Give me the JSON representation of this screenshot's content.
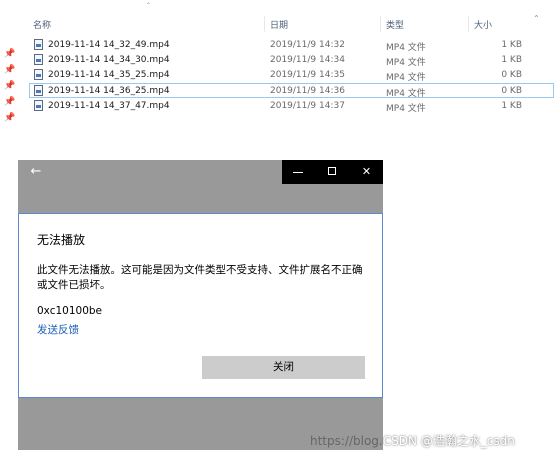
{
  "explorer": {
    "columns": {
      "name": "名称",
      "date": "日期",
      "type": "类型",
      "size": "大小"
    },
    "files": [
      {
        "name": "2019-11-14 14_32_49.mp4",
        "date": "2019/11/9 14:32",
        "type": "MP4 文件",
        "size": "1 KB",
        "selected": false
      },
      {
        "name": "2019-11-14 14_34_30.mp4",
        "date": "2019/11/9 14:34",
        "type": "MP4 文件",
        "size": "1 KB",
        "selected": false
      },
      {
        "name": "2019-11-14 14_35_25.mp4",
        "date": "2019/11/9 14:35",
        "type": "MP4 文件",
        "size": "0 KB",
        "selected": false
      },
      {
        "name": "2019-11-14 14_36_25.mp4",
        "date": "2019/11/9 14:36",
        "type": "MP4 文件",
        "size": "0 KB",
        "selected": true
      },
      {
        "name": "2019-11-14 14_37_47.mp4",
        "date": "2019/11/9 14:37",
        "type": "MP4 文件",
        "size": "1 KB",
        "selected": false
      }
    ],
    "icons": {
      "pin": "pin-icon",
      "file": "file-icon",
      "sort": "sort-indicator-icon",
      "collapse": "chevron-up-icon"
    }
  },
  "player": {
    "controls": {
      "back": "←",
      "close": "✕"
    },
    "dialog": {
      "title": "无法播放",
      "message": "此文件无法播放。这可能是因为文件类型不受支持、文件扩展名不正确或文件已损坏。",
      "error_code": "0xc10100be",
      "feedback_link": "发送反馈",
      "close_button": "关闭"
    }
  },
  "watermark": {
    "url_text": "https://blog.",
    "csdn_text": "CSDN @浩瀚之水_csdn"
  },
  "colors": {
    "accent": "#1a5fb4",
    "selection_border": "#99c9ef",
    "player_background": "#999999",
    "title_controls_background": "#000000",
    "dialog_border": "#5a8bd0"
  }
}
